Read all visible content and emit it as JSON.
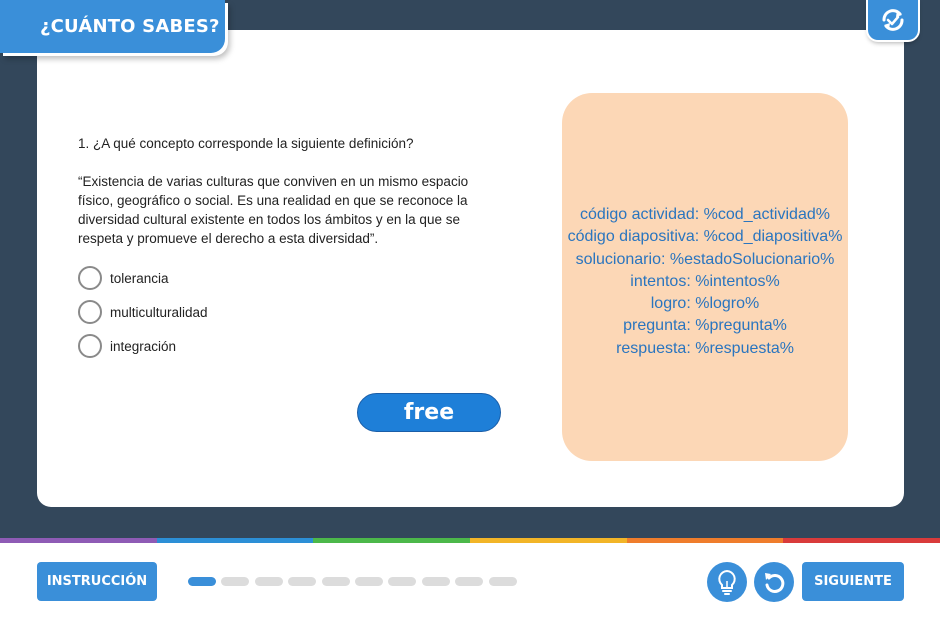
{
  "header": {
    "title": "¿CUÁNTO SABES?",
    "refresh_icon": "refresh-icon"
  },
  "question": {
    "prompt": "1. ¿A qué concepto corresponde la siguiente definición?",
    "definition": "“Existencia de varias culturas que conviven en un mismo espacio físico, geográfico o social. Es una realidad en que se reconoce la diversidad cultural existente en todos los ámbitos y en la que se respeta y promueve el derecho a esta diversidad”.",
    "options": [
      {
        "label": "tolerancia"
      },
      {
        "label": "multiculturalidad"
      },
      {
        "label": "integración"
      }
    ],
    "free_button": "free"
  },
  "info_panel": {
    "lines": [
      "código actividad: %cod_actividad%",
      "código diapositiva: %cod_diapositiva%",
      "solucionario: %estadoSolucionario%",
      "intentos: %intentos%",
      "logro: %logro%",
      "pregunta: %pregunta%",
      "respuesta: %respuesta%"
    ]
  },
  "footer": {
    "instruction_button": "INSTRUCCIÓN",
    "next_button": "SIGUIENTE",
    "hint_icon": "lightbulb-icon",
    "undo_icon": "undo-icon",
    "progress": {
      "current": 1,
      "total": 10
    }
  },
  "colors": {
    "primary": "#3a8fd9",
    "frame": "#33475b",
    "panel": "#fcd7b6",
    "panel_text": "#2a75bf",
    "rainbow": [
      "#8e5bb5",
      "#2c8fd6",
      "#4cb84a",
      "#f2b528",
      "#ef7d2c",
      "#d93b3b"
    ]
  }
}
